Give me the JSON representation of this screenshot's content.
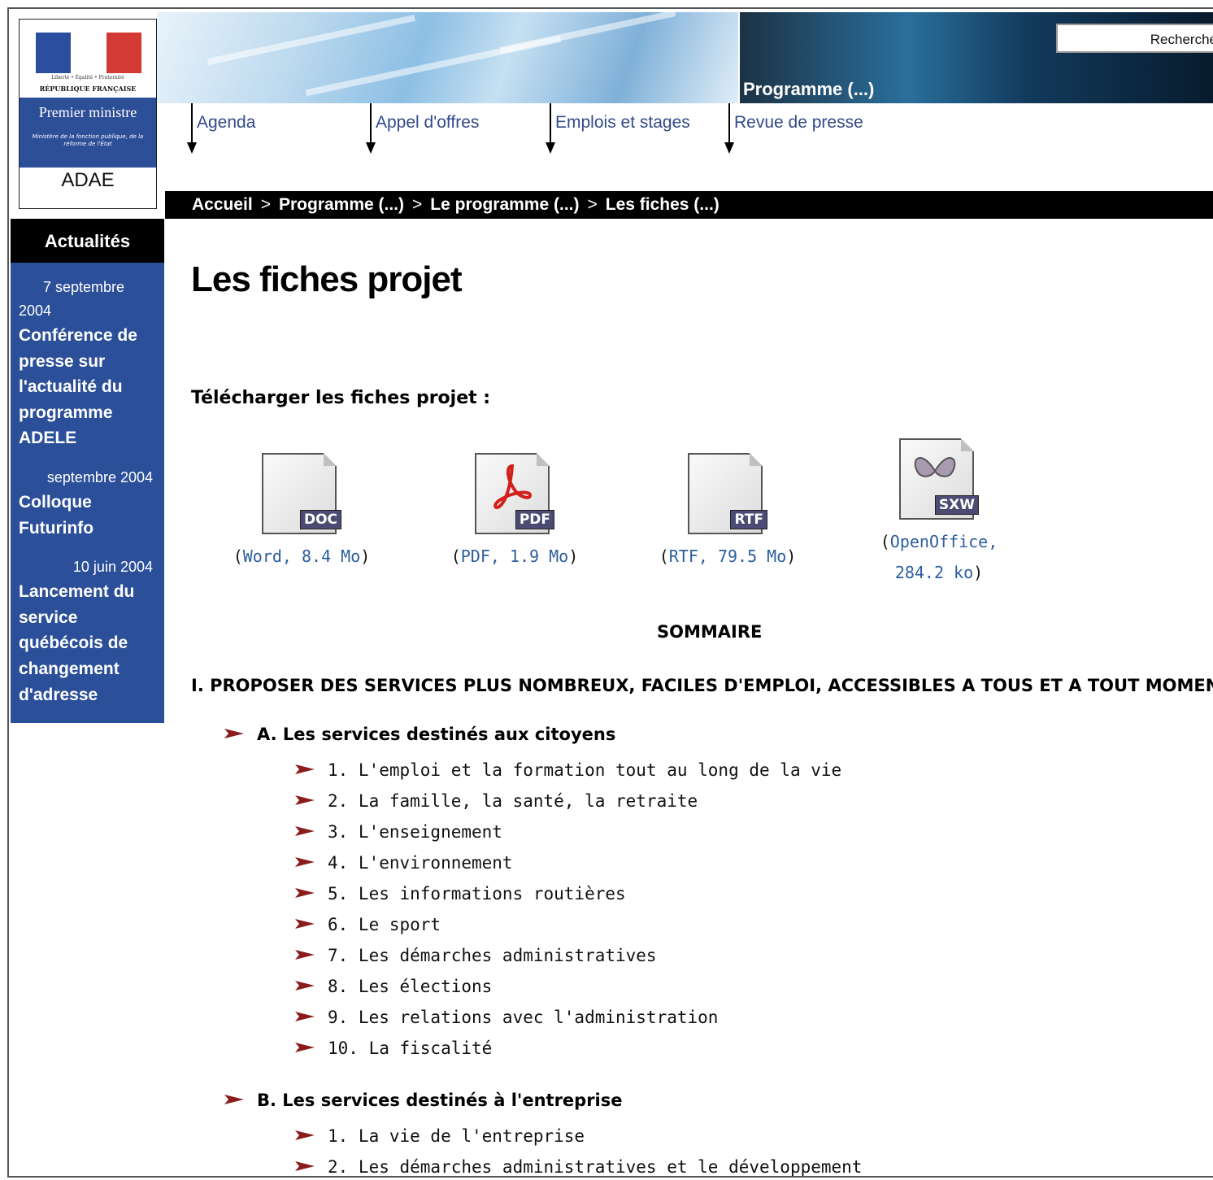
{
  "logo": {
    "motto": "Liberté • Égalité • Fraternité",
    "republic": "RÉPUBLIQUE FRANÇAISE",
    "premier_ministre": "Premier ministre",
    "ministere": "Ministère de la fonction publique, de la réforme de l'État",
    "org": "ADAE"
  },
  "header": {
    "section_title": "Programme  (...)",
    "search_label": "Recherche"
  },
  "nav": {
    "items": [
      {
        "label": "Agenda"
      },
      {
        "label": "Appel d'offres"
      },
      {
        "label": "Emplois et stages"
      },
      {
        "label": "Revue de presse"
      }
    ]
  },
  "breadcrumb": {
    "items": [
      "Accueil",
      "Programme  (...)",
      "Le programme  (...)",
      "Les fiches  (...)"
    ],
    "separator": ">"
  },
  "sidebar": {
    "heading": "Actualités",
    "news": [
      {
        "date": "7 septembre 2004",
        "title": "Conférence de presse sur l'actualité du programme ADELE"
      },
      {
        "date": "septembre 2004",
        "title": "Colloque Futurinfo"
      },
      {
        "date": "10 juin 2004",
        "title": "Lancement du service québécois de changement d'adresse"
      }
    ]
  },
  "main": {
    "title": "Les fiches projet",
    "download_label": "Télécharger les fiches projet :",
    "downloads": [
      {
        "badge": "DOC",
        "icon": "word-document-icon",
        "prefix": "(",
        "link": "Word, 8.4 Mo",
        "suffix": ")"
      },
      {
        "badge": "PDF",
        "icon": "pdf-document-icon",
        "prefix": "(",
        "link": "PDF, 1.9 Mo",
        "suffix": ")"
      },
      {
        "badge": "RTF",
        "icon": "rtf-document-icon",
        "prefix": "(",
        "link": "RTF, 79.5 Mo",
        "suffix": ")"
      },
      {
        "badge": "SXW",
        "icon": "openoffice-document-icon",
        "prefix": "(",
        "link": "OpenOffice,",
        "link2": "284.2 ko",
        "suffix": ")"
      }
    ],
    "summary_title": "SOMMAIRE",
    "section1": "I. PROPOSER DES SERVICES PLUS NOMBREUX, FACILES D'EMPLOI, ACCESSIBLES A TOUS ET A TOUT MOMENT",
    "subsectionA": {
      "title": "A. Les services destinés aux citoyens",
      "items": [
        "1. L'emploi et la formation tout au long de la vie",
        "2. La famille, la santé, la retraite",
        "3. L'enseignement",
        "4. L'environnement",
        "5. Les informations routières",
        "6. Le sport",
        "7. Les démarches administratives",
        "8. Les élections",
        "9. Les relations avec l'administration",
        "10. La fiscalité"
      ]
    },
    "subsectionB": {
      "title": "B. Les services destinés à l'entreprise",
      "items": [
        "1. La vie de l'entreprise",
        "2. Les démarches administratives et le développement"
      ]
    }
  },
  "colors": {
    "sidebar_blue": "#2b4f98",
    "bullet_red": "#8b1c1c",
    "link_blue": "#2c5e9e"
  }
}
